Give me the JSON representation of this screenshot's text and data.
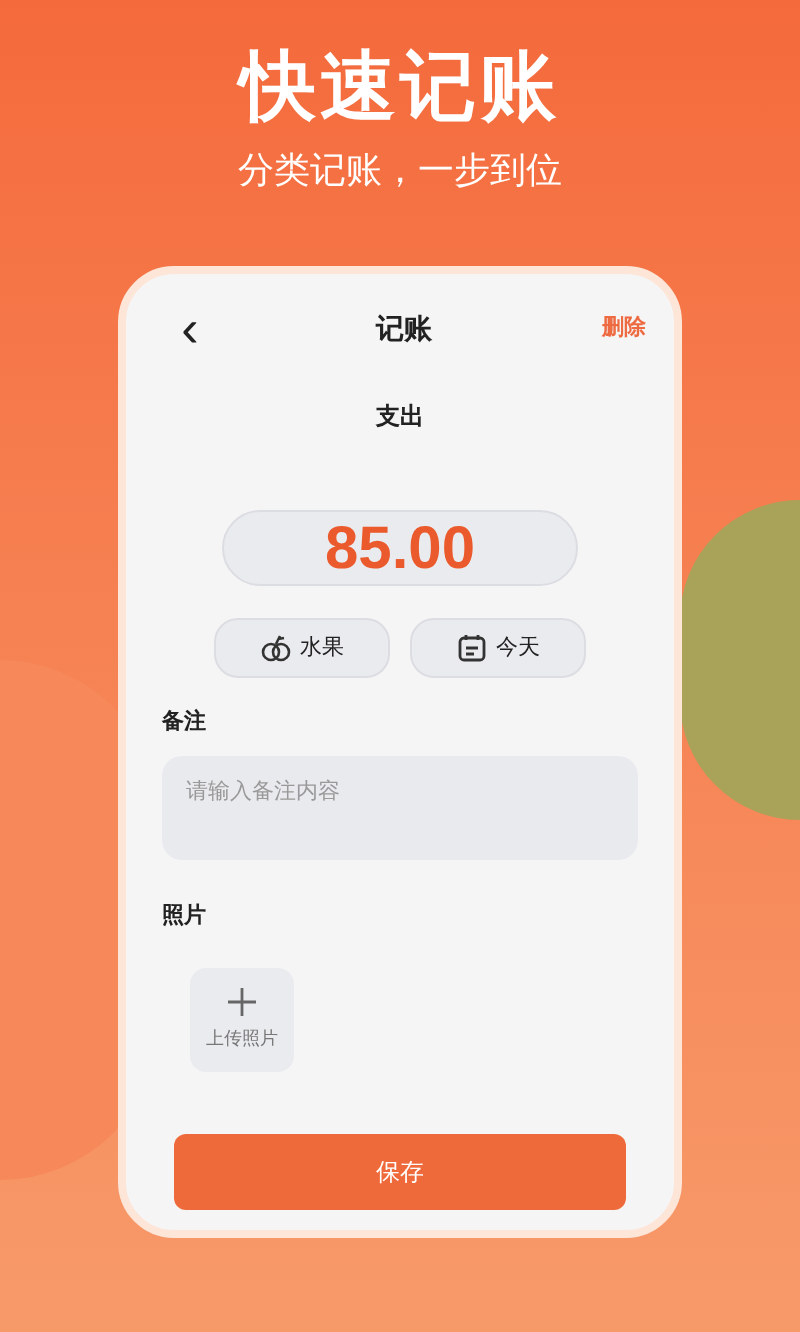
{
  "banner": {
    "title": "快速记账",
    "subtitle": "分类记账，一步到位"
  },
  "screen": {
    "nav": {
      "back": "‹",
      "title": "记账",
      "action": "删除"
    },
    "type_label": "支出",
    "amount": "85.00",
    "chips": [
      {
        "kind": "category",
        "label": "水果"
      },
      {
        "kind": "date",
        "label": "今天"
      }
    ],
    "note": {
      "label": "备注",
      "placeholder": "请输入备注内容"
    },
    "photos": {
      "label": "照片",
      "upload": "上传照片"
    },
    "save": "保存"
  }
}
